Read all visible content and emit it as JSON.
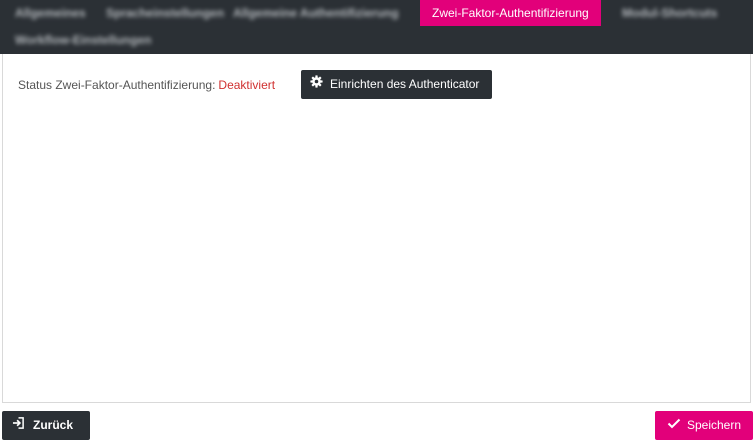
{
  "tabs": [
    {
      "label": "Allgemeines",
      "active": false
    },
    {
      "label": "Spracheinstellungen",
      "active": false
    },
    {
      "label": "Allgemeine Authentifizierung",
      "active": false
    },
    {
      "label": "Zwei-Faktor-Authentifizierung",
      "active": true
    },
    {
      "label": "Modul-Shortcuts",
      "active": false
    },
    {
      "label": "Workflow-Einstellungen",
      "active": false
    }
  ],
  "content": {
    "status_label": "Status Zwei-Faktor-Authentifizierung:",
    "status_value": "Deaktiviert",
    "setup_button_label": "Einrichten des Authenticator"
  },
  "footer": {
    "back_label": "Zurück",
    "save_label": "Speichern"
  },
  "colors": {
    "header_bg": "#2b3035",
    "accent": "#e2007a",
    "status_inactive": "#d0302f"
  },
  "icons": {
    "setup": "gear-icon",
    "back": "sign-in-icon",
    "save": "check-icon"
  }
}
